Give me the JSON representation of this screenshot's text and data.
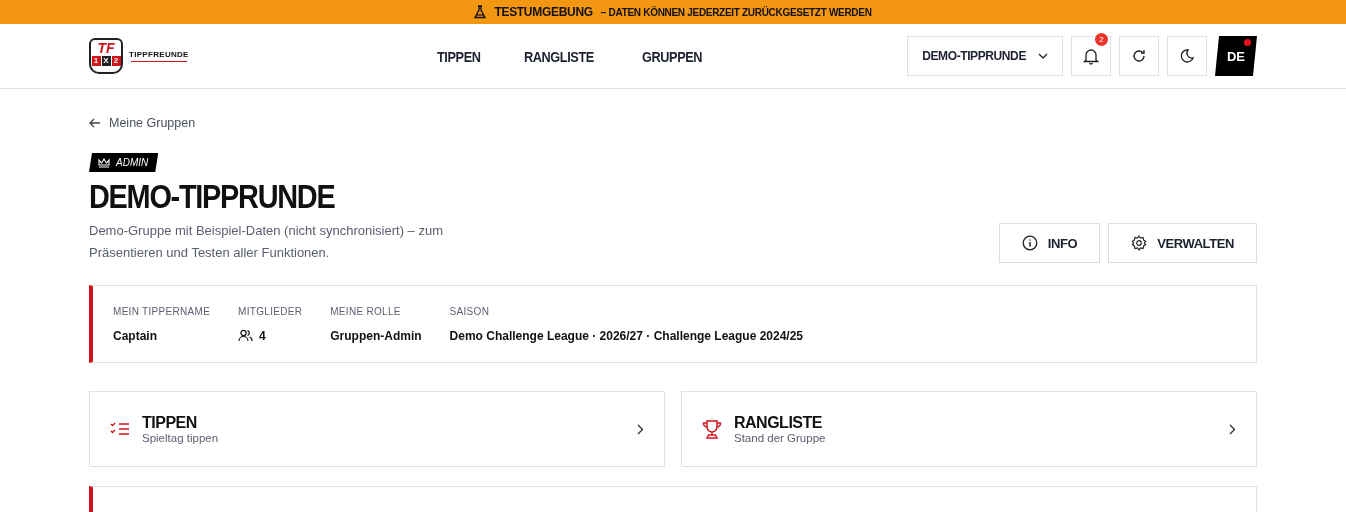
{
  "banner": {
    "title": "TESTUMGEBUNG",
    "message": "– DATEN KÖNNEN JEDERZEIT ZURÜCKGESETZT WERDEN"
  },
  "logo": {
    "mark": "TF",
    "picks": [
      "1",
      "X",
      "2"
    ],
    "name": "TIPPFREUNDE"
  },
  "nav": [
    {
      "label": "TIPPEN"
    },
    {
      "label": "RANGLISTE"
    },
    {
      "label": "GRUPPEN"
    }
  ],
  "group_select": {
    "value": "DEMO-TIPPRUNDE"
  },
  "notifications": {
    "count": "2"
  },
  "language": {
    "label": "DE",
    "alert": true
  },
  "back_link": "Meine Gruppen",
  "role_badge": "ADMIN",
  "title": "DEMO-TIPPRUNDE",
  "description": "Demo-Gruppe mit Beispiel-Daten (nicht synchronisiert) – zum Präsentieren und Testen aller Funktionen.",
  "actions": [
    {
      "label": "INFO",
      "kind": "info"
    },
    {
      "label": "VERWALTEN",
      "kind": "settings"
    }
  ],
  "stats": [
    {
      "label": "MEIN TIPPERNAME",
      "value": "Captain",
      "kind": "text"
    },
    {
      "label": "MITGLIEDER",
      "value": "4",
      "kind": "members"
    },
    {
      "label": "MEINE ROLLE",
      "value": "Gruppen-Admin",
      "kind": "text"
    },
    {
      "label": "SAISON",
      "value": "Demo Challenge League · 2026/27 · Challenge League 2024/25",
      "kind": "text"
    }
  ],
  "cards": [
    {
      "title": "TIPPEN",
      "subtitle": "Spieltag tippen",
      "kind": "tips"
    },
    {
      "title": "RANGLISTE",
      "subtitle": "Stand der Gruppe",
      "kind": "ranking"
    }
  ]
}
